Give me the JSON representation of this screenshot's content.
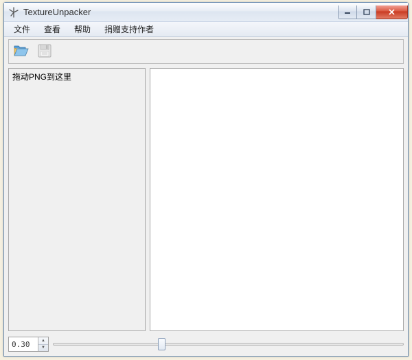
{
  "window": {
    "title": "TextureUnpacker"
  },
  "menu": {
    "items": [
      "文件",
      "查看",
      "帮助",
      "捐赠支持作者"
    ]
  },
  "panes": {
    "drop_hint": "拖动PNG到这里"
  },
  "footer": {
    "spinner_value": "0.30",
    "slider_percent": 30
  }
}
